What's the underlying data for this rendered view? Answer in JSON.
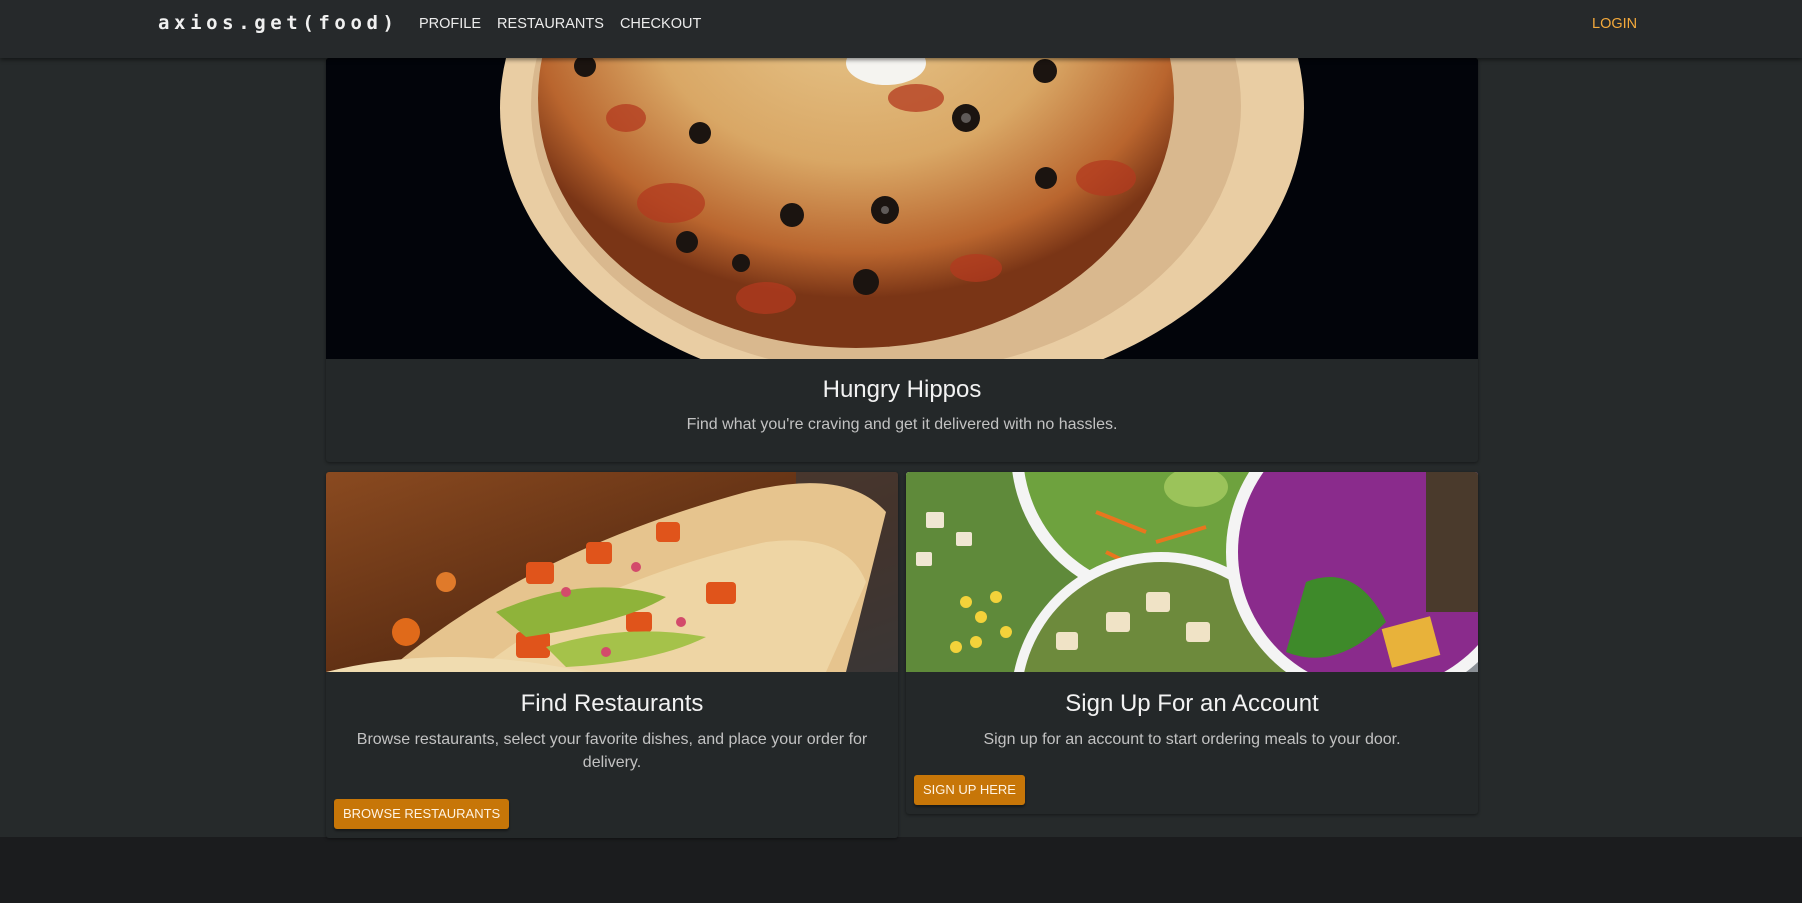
{
  "navbar": {
    "brand": "axios.get(food)",
    "links": [
      "PROFILE",
      "RESTAURANTS",
      "CHECKOUT"
    ],
    "login": "LOGIN"
  },
  "hero": {
    "image": "pizza-photo",
    "title": "Hungry Hippos",
    "subtitle": "Find what you're craving and get it delivered with no hassles."
  },
  "cards": [
    {
      "image": "tacos-photo",
      "title": "Find Restaurants",
      "text": "Browse restaurants, select your favorite dishes, and place your order for delivery.",
      "button": "BROWSE RESTAURANTS"
    },
    {
      "image": "salad-bowls-photo",
      "title": "Sign Up For an Account",
      "text": "Sign up for an account to start ordering meals to your door.",
      "button": "SIGN UP HERE"
    }
  ],
  "colors": {
    "accent": "#c77608",
    "login": "#f4a93b",
    "background": "#262a2b",
    "footer": "#1b1c1e"
  }
}
